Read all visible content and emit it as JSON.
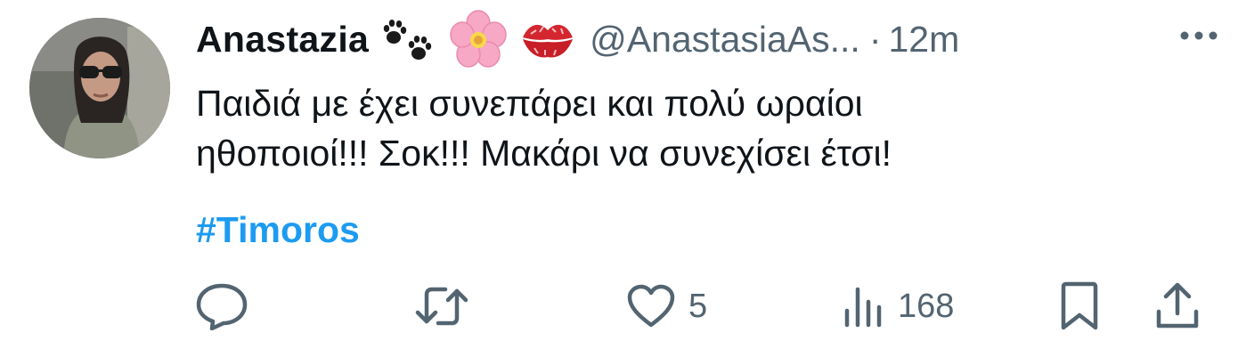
{
  "tweet": {
    "author": {
      "display_name": "Anastazia",
      "emojis": [
        "paw-prints",
        "cherry-blossom",
        "kiss-mark"
      ],
      "handle": "@AnastasiaAs...",
      "separator": "·",
      "time": "12m"
    },
    "text_lines": [
      "Παιδιά με έχει συνεπάρει και πολύ ωραίοι",
      "ηθοποιοί!!! Σοκ!!! Μακάρι να συνεχίσει έτσι!"
    ],
    "hashtag": "#Timoros",
    "actions": {
      "reply": {
        "icon": "reply-icon",
        "count": ""
      },
      "retweet": {
        "icon": "retweet-icon",
        "count": ""
      },
      "like": {
        "icon": "heart-icon",
        "count": "5"
      },
      "views": {
        "icon": "views-icon",
        "count": "168"
      },
      "bookmark": {
        "icon": "bookmark-icon"
      },
      "share": {
        "icon": "share-icon"
      }
    }
  },
  "colors": {
    "text": "#0f1419",
    "secondary": "#536471",
    "link": "#1d9bf0"
  }
}
